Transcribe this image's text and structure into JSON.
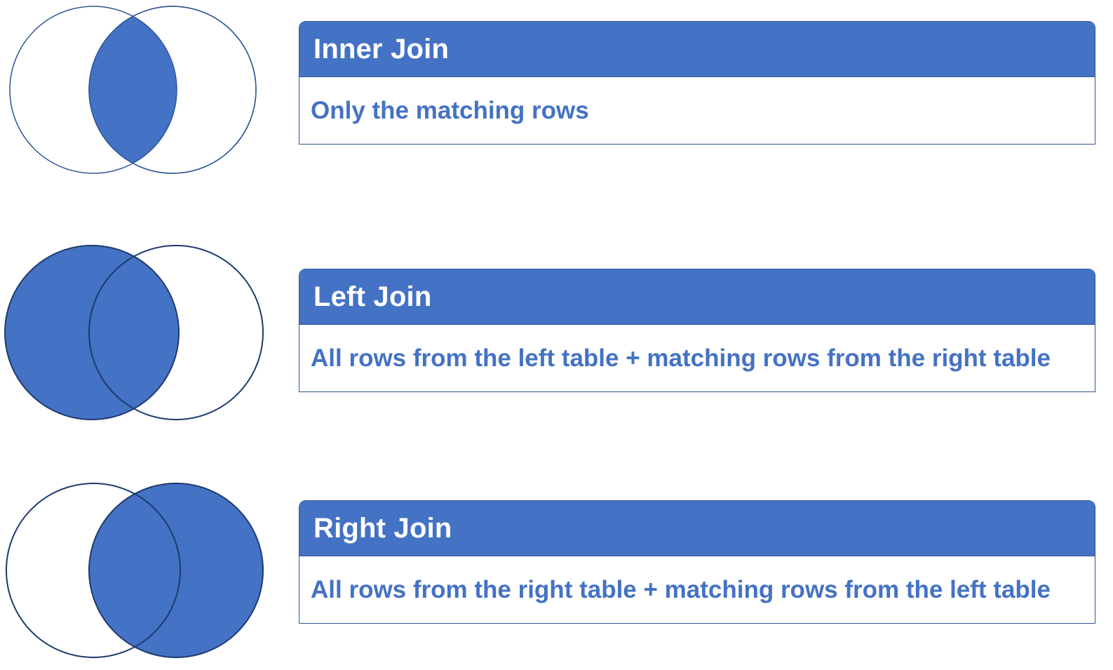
{
  "colors": {
    "fill": "#4472C4",
    "stroke": "#2F5597",
    "background": "#ffffff"
  },
  "joins": [
    {
      "title": "Inner Join",
      "description": "Only the matching rows",
      "highlight": "intersection"
    },
    {
      "title": "Left Join",
      "description": "All rows from the left table + matching rows from the right table",
      "highlight": "left"
    },
    {
      "title": "Right Join",
      "description": "All rows from the right table + matching rows from the left table",
      "highlight": "right"
    }
  ]
}
